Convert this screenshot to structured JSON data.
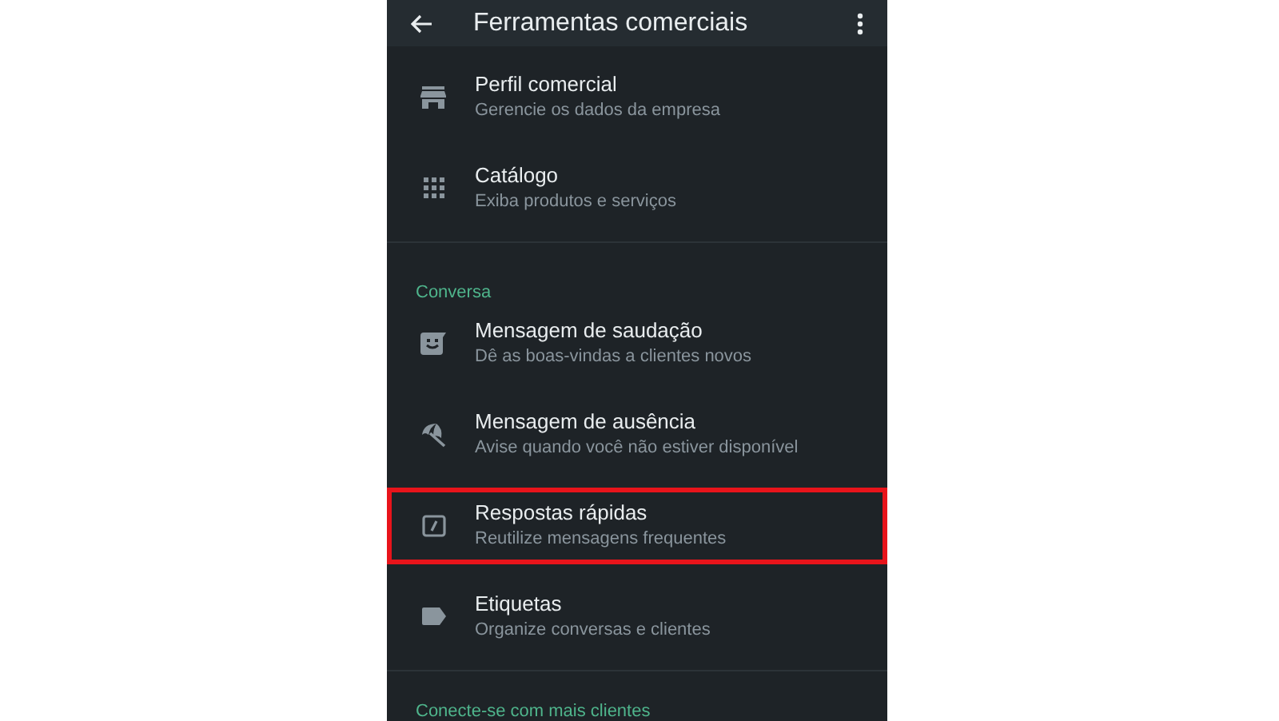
{
  "app_bar": {
    "title": "Ferramentas comerciais"
  },
  "sections": [
    {
      "items": [
        {
          "kind": "store",
          "title": "Perfil comercial",
          "subtitle": "Gerencie os dados da empresa",
          "highlighted": false
        },
        {
          "kind": "grid",
          "title": "Catálogo",
          "subtitle": "Exiba produtos e serviços",
          "highlighted": false
        }
      ]
    },
    {
      "header": "Conversa",
      "items": [
        {
          "kind": "greeting",
          "title": "Mensagem de saudação",
          "subtitle": "Dê as boas-vindas a clientes novos",
          "highlighted": false
        },
        {
          "kind": "umbrella",
          "title": "Mensagem de ausência",
          "subtitle": "Avise quando você não estiver disponível",
          "highlighted": false
        },
        {
          "kind": "quick-reply",
          "title": "Respostas rápidas",
          "subtitle": "Reutilize mensagens frequentes",
          "highlighted": true
        },
        {
          "kind": "label",
          "title": "Etiquetas",
          "subtitle": "Organize conversas e clientes",
          "highlighted": false
        }
      ]
    },
    {
      "header": "Conecte-se com mais clientes"
    }
  ]
}
